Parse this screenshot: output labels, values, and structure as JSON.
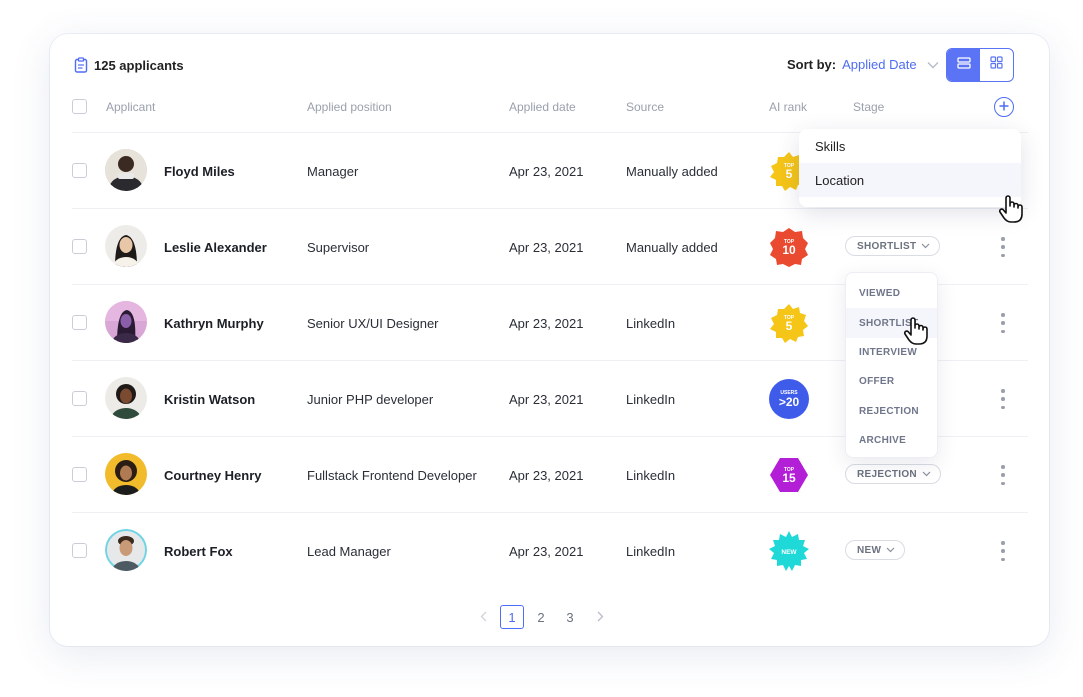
{
  "header": {
    "applicant_count": "125 applicants",
    "sort_label": "Sort by:",
    "sort_value": "Applied Date"
  },
  "columns": [
    "Applicant",
    "Applied position",
    "Applied date",
    "Source",
    "AI rank",
    "Stage"
  ],
  "rows": [
    {
      "name": "Floyd Miles",
      "position": "Manager",
      "date": "Apr 23, 2021",
      "source": "Manually added",
      "rank_top": "TOP",
      "rank_num": "5",
      "stage": ""
    },
    {
      "name": "Leslie Alexander",
      "position": "Supervisor",
      "date": "Apr 23, 2021",
      "source": "Manually added",
      "rank_top": "TOP",
      "rank_num": "10",
      "stage": "SHORTLIST"
    },
    {
      "name": "Kathryn Murphy",
      "position": "Senior UX/UI Designer",
      "date": "Apr 23, 2021",
      "source": "LinkedIn",
      "rank_top": "TOP",
      "rank_num": "5",
      "stage": ""
    },
    {
      "name": "Kristin Watson",
      "position": "Junior PHP developer",
      "date": "Apr 23, 2021",
      "source": "LinkedIn",
      "rank_top": "USERS",
      "rank_num": ">20",
      "stage": ""
    },
    {
      "name": "Courtney Henry",
      "position": "Fullstack Frontend Developer",
      "date": "Apr 23, 2021",
      "source": "LinkedIn",
      "rank_top": "TOP",
      "rank_num": "15",
      "stage": "REJECTION"
    },
    {
      "name": "Robert Fox",
      "position": "Lead Manager",
      "date": "Apr 23, 2021",
      "source": "LinkedIn",
      "rank_top": "",
      "rank_num": "NEW",
      "stage": "NEW"
    }
  ],
  "column_menu": [
    "Skills",
    "Location"
  ],
  "stage_menu": [
    "VIEWED",
    "SHORTLIST",
    "INTERVIEW",
    "OFFER",
    "REJECTION",
    "ARCHIVE"
  ],
  "pagination": [
    "1",
    "2",
    "3"
  ],
  "colors": {
    "accent": "#4e6cf5",
    "rank_gold": "#f5c518",
    "rank_red": "#ea4a2f",
    "rank_blue": "#3f5bea",
    "rank_purple": "#b21fd6",
    "rank_teal": "#1fd8d8"
  },
  "icons": {
    "count": "clipboard-icon",
    "sort": "chevron-down-icon",
    "list_view": "list-view-icon",
    "grid_view": "grid-view-icon",
    "add_column": "plus-circle-icon",
    "row_menu": "kebab-icon",
    "pointer": "hand-pointer-icon"
  }
}
